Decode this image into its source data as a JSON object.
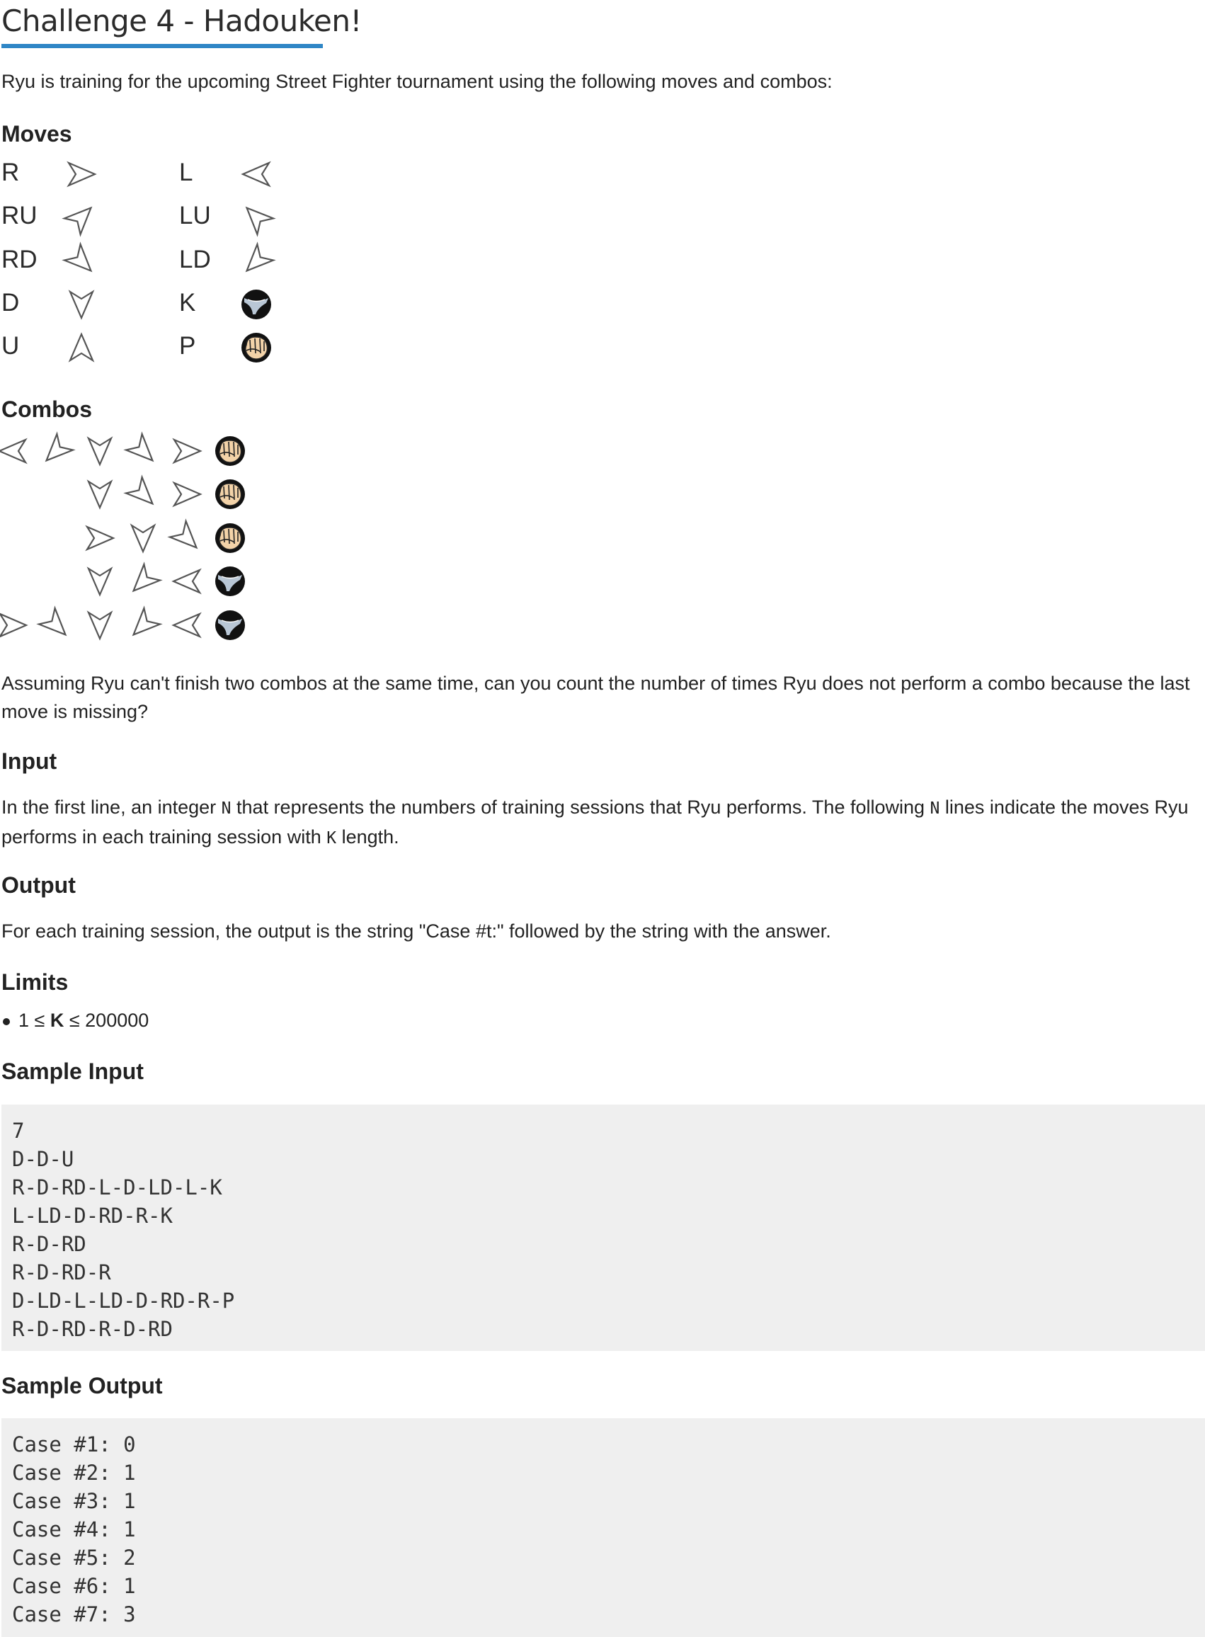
{
  "title": "Challenge 4 - Hadouken!",
  "intro": "Ryu is training for the upcoming Street Fighter tournament using the following moves and combos:",
  "moves_heading": "Moves",
  "moves": [
    {
      "label": "R",
      "icon": "arrow-right-icon"
    },
    {
      "label": "L",
      "icon": "arrow-left-icon"
    },
    {
      "label": "RU",
      "icon": "arrow-right-up-icon"
    },
    {
      "label": "LU",
      "icon": "arrow-left-up-icon"
    },
    {
      "label": "RD",
      "icon": "arrow-right-down-icon"
    },
    {
      "label": "LD",
      "icon": "arrow-left-down-icon"
    },
    {
      "label": "D",
      "icon": "arrow-down-icon"
    },
    {
      "label": "K",
      "icon": "kick-icon"
    },
    {
      "label": "U",
      "icon": "arrow-up-icon"
    },
    {
      "label": "P",
      "icon": "punch-icon"
    }
  ],
  "combos_heading": "Combos",
  "combos": [
    [
      "L",
      "LD",
      "D",
      "RD",
      "R",
      "P"
    ],
    [
      "D",
      "RD",
      "R",
      "P"
    ],
    [
      "R",
      "D",
      "RD",
      "P"
    ],
    [
      "D",
      "LD",
      "L",
      "K"
    ],
    [
      "R",
      "RD",
      "D",
      "LD",
      "L",
      "K"
    ]
  ],
  "question": "Assuming Ryu can't finish two combos at the same time, can you count the number of times Ryu does not perform a combo because the last move is missing?",
  "input_heading": "Input",
  "input_text": {
    "p1": "In the first line, an integer ",
    "n1": "N",
    "p2": " that represents the numbers of training sessions that Ryu performs. The following ",
    "n2": "N",
    "p3": " lines indicate the moves Ryu performs in each training session with ",
    "k": "K",
    "p4": " length."
  },
  "output_heading": "Output",
  "output_text": "For each training session, the output is the string \"Case #t:\" followed by the string with the answer.",
  "limits_heading": "Limits",
  "limit": {
    "pre": "1 ≤ ",
    "var": "K",
    "post": " ≤ 200000"
  },
  "sample_input_heading": "Sample Input",
  "sample_input": [
    "7",
    "D-D-U",
    "R-D-RD-L-D-LD-L-K",
    "L-LD-D-RD-R-K",
    "R-D-RD",
    "R-D-RD-R",
    "D-LD-L-LD-D-RD-R-P",
    "R-D-RD-R-D-RD"
  ],
  "sample_output_heading": "Sample Output",
  "sample_output": [
    "Case #1: 0",
    "Case #2: 1",
    "Case #3: 1",
    "Case #4: 1",
    "Case #5: 2",
    "Case #6: 1",
    "Case #7: 3"
  ],
  "colors": {
    "title_rule": "#2f86c6",
    "code_bg": "#efefef",
    "punch_skin": "#f3d3a9"
  }
}
